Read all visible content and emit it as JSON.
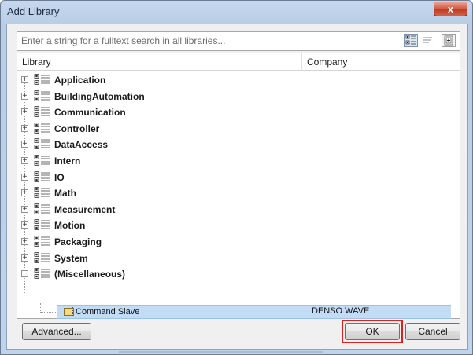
{
  "window": {
    "title": "Add Library",
    "close_glyph": "x"
  },
  "search": {
    "placeholder": "Enter a string for a fulltext search in all libraries..."
  },
  "columns": {
    "library": "Library",
    "company": "Company"
  },
  "tree": {
    "libraries": [
      {
        "label": "Application",
        "expander": "+"
      },
      {
        "label": "BuildingAutomation",
        "expander": "+"
      },
      {
        "label": "Communication",
        "expander": "+"
      },
      {
        "label": "Controller",
        "expander": "+"
      },
      {
        "label": "DataAccess",
        "expander": "+"
      },
      {
        "label": "Intern",
        "expander": "+"
      },
      {
        "label": "IO",
        "expander": "+"
      },
      {
        "label": "Math",
        "expander": "+"
      },
      {
        "label": "Measurement",
        "expander": "+"
      },
      {
        "label": "Motion",
        "expander": "+"
      },
      {
        "label": "Packaging",
        "expander": "+"
      },
      {
        "label": "System",
        "expander": "+"
      },
      {
        "label": "(Miscellaneous)",
        "expander": "−"
      }
    ],
    "selected_item": {
      "name": "Command Slave",
      "company": "DENSO WAVE"
    }
  },
  "buttons": {
    "advanced": "Advanced...",
    "ok": "OK",
    "cancel": "Cancel"
  },
  "icons": {
    "tree_view": "tree-view-icon",
    "list_view": "list-view-icon",
    "new_view": "add-view-icon",
    "library": "library-icon",
    "selected": "library-module-icon"
  },
  "colors": {
    "highlight_frame": "#e0201c",
    "selection": "#c3dcf5"
  }
}
